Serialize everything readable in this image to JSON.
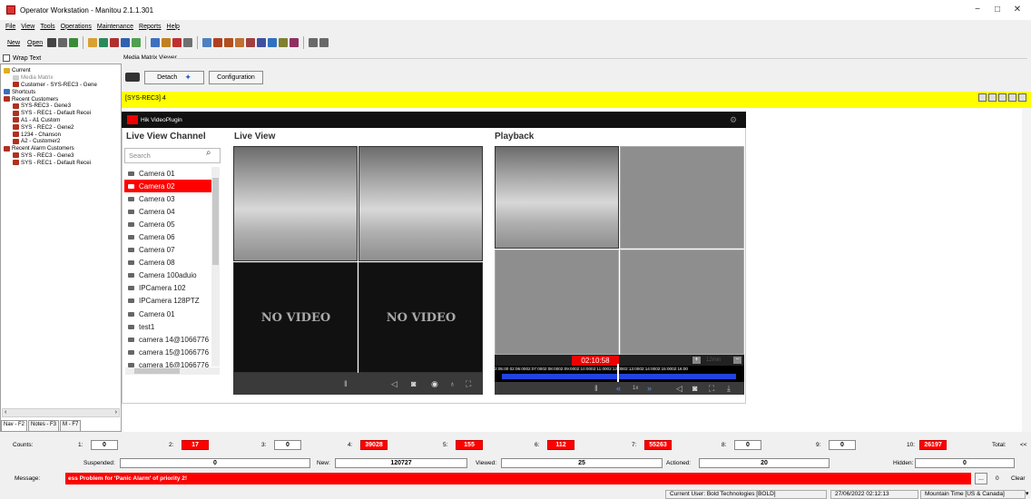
{
  "window": {
    "title": "Operator Workstation - Manitou 2.1.1.301",
    "minimize": "−",
    "maximize": "□",
    "close": "✕"
  },
  "menu": [
    "File",
    "View",
    "Tools",
    "Operations",
    "Maintenance",
    "Reports",
    "Help"
  ],
  "toolbar": {
    "new_label": "New",
    "open_label": "Open"
  },
  "nav": {
    "wrap_text": "Wrap Text",
    "tree": [
      {
        "label": "Current",
        "indent": 0,
        "icon_color": "#e0b020"
      },
      {
        "label": "Media Matrix",
        "indent": 2,
        "icon_color": "#cfcfcf",
        "muted": true
      },
      {
        "label": "Customer - SYS-REC3 - Gene",
        "indent": 2,
        "icon_color": "#b03020"
      },
      {
        "label": "Shortcuts",
        "indent": 0,
        "icon_color": "#3a6fbf"
      },
      {
        "label": "Recent Customers",
        "indent": 0,
        "icon_color": "#b03020"
      },
      {
        "label": "SYS-REC3 - Gene3",
        "indent": 2,
        "icon_color": "#b03020"
      },
      {
        "label": "SYS - REC1 - Default Recei",
        "indent": 2,
        "icon_color": "#b03020"
      },
      {
        "label": "A1 - A1 Custom",
        "indent": 2,
        "icon_color": "#b03020"
      },
      {
        "label": "SYS - REC2 - Gene2",
        "indent": 2,
        "icon_color": "#b03020"
      },
      {
        "label": "1234 - Chanson",
        "indent": 2,
        "icon_color": "#b03020"
      },
      {
        "label": "A2 - Customer2",
        "indent": 2,
        "icon_color": "#b03020"
      },
      {
        "label": "Recent Alarm Customers",
        "indent": 0,
        "icon_color": "#b03020"
      },
      {
        "label": "SYS - REC3 - Gene3",
        "indent": 2,
        "icon_color": "#b03020"
      },
      {
        "label": "SYS - REC1 - Default Recei",
        "indent": 2,
        "icon_color": "#b03020"
      }
    ],
    "tabs": [
      "Nav - F2",
      "Notes - F3",
      "M - F7"
    ]
  },
  "media_matrix": {
    "legend": "Media Matrix Viewer",
    "detach_label": "Detach",
    "configuration_label": "Configuration",
    "site_label": "[SYS-REC3] 4"
  },
  "plugin": {
    "name": "Hik VideoPlugin",
    "live_view_channel_title": "Live View Channel",
    "live_view_title": "Live View",
    "playback_title": "Playback",
    "search_placeholder": "Search",
    "cameras": [
      "Camera 01",
      "Camera 02",
      "Camera 03",
      "Camera 04",
      "Camera 05",
      "Camera 06",
      "Camera 07",
      "Camera 08",
      "Camera 100aduio",
      "IPCamera 102",
      "IPCamera 128PTZ",
      "Camera 01",
      "test1",
      "camera 14@1066776",
      "camera 15@1066776",
      "camera 16@1066776"
    ],
    "selected_camera_index": 1,
    "no_video_text": "NO VIDEO",
    "playback_time": "02:10:58",
    "timeline_text": "2:05:00 02:06:0002:07:0002:08:0002:09:0002:10:0002:11:0002:12:0002:13:0002:14:0002:15:0002:16:00",
    "zoom_label": "12min",
    "speed_label": "1x"
  },
  "counts": {
    "label": "Counts:",
    "items": [
      {
        "n": "1:",
        "value": "0",
        "red": false
      },
      {
        "n": "2:",
        "value": "17",
        "red": true
      },
      {
        "n": "3:",
        "value": "0",
        "red": false
      },
      {
        "n": "4:",
        "value": "39028",
        "red": true
      },
      {
        "n": "5:",
        "value": "155",
        "red": true
      },
      {
        "n": "6:",
        "value": "112",
        "red": true
      },
      {
        "n": "7:",
        "value": "55263",
        "red": true
      },
      {
        "n": "8:",
        "value": "0",
        "red": false
      },
      {
        "n": "9:",
        "value": "0",
        "red": false
      },
      {
        "n": "10:",
        "value": "26197",
        "red": true
      }
    ],
    "total_label": "Total:",
    "more": "<<"
  },
  "summary": {
    "suspended_label": "Suspended:",
    "suspended": "0",
    "new_label": "New:",
    "new": "120727",
    "viewed_label": "Viewed:",
    "viewed": "25",
    "actioned_label": "Actioned:",
    "actioned": "20",
    "hidden_label": "Hidden:",
    "hidden": "0"
  },
  "message": {
    "label": "Message:",
    "text": "ess Problem for 'Panic Alarm' of priority 2!",
    "ellipsis": "...",
    "count": "0",
    "clear_label": "Clear"
  },
  "status": {
    "user": "Current User:  Bold Technologies [BOLD]",
    "datetime": "27/06/2022 02:12:13",
    "timezone": "Mountain Time [US & Canada]"
  }
}
